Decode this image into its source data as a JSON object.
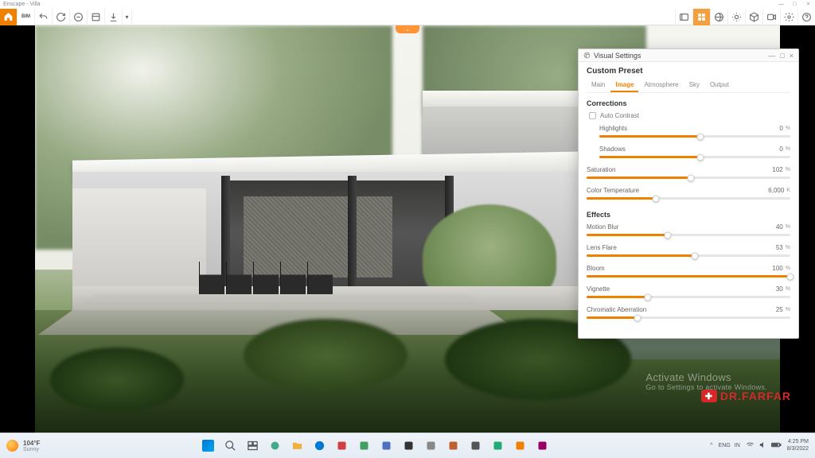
{
  "app": {
    "title": "Enscape - Villa"
  },
  "window_controls": {
    "min": "—",
    "max": "□",
    "close": "×"
  },
  "toolbar_left": [
    "home",
    "bim",
    "undo",
    "sync",
    "filter",
    "layers",
    "export",
    "dropdown"
  ],
  "toolbar_right": [
    "renders",
    "styles-active",
    "globe",
    "sun",
    "package",
    "video",
    "settings",
    "help"
  ],
  "handle_icon": "⌄",
  "panel": {
    "title": "Visual Settings",
    "preset": "Custom Preset",
    "tabs": [
      "Main",
      "Image",
      "Atmosphere",
      "Sky",
      "Output"
    ],
    "active_tab": 1,
    "section_corrections": "Corrections",
    "auto_contrast": {
      "label": "Auto Contrast",
      "checked": false
    },
    "sliders_corrections": [
      {
        "label": "Highlights",
        "value": 0,
        "unit": "%",
        "pct": 53,
        "indent": true
      },
      {
        "label": "Shadows",
        "value": 0,
        "unit": "%",
        "pct": 53,
        "indent": true
      },
      {
        "label": "Saturation",
        "value": 102,
        "unit": "%",
        "pct": 51
      },
      {
        "label": "Color Temperature",
        "value": "6,000",
        "unit": "K",
        "pct": 34
      }
    ],
    "section_effects": "Effects",
    "sliders_effects": [
      {
        "label": "Motion Blur",
        "value": 40,
        "unit": "%",
        "pct": 40
      },
      {
        "label": "Lens Flare",
        "value": 53,
        "unit": "%",
        "pct": 53
      },
      {
        "label": "Bloom",
        "value": 100,
        "unit": "%",
        "pct": 100
      },
      {
        "label": "Vignette",
        "value": 30,
        "unit": "%",
        "pct": 30
      },
      {
        "label": "Chromatic Aberration",
        "value": 25,
        "unit": "%",
        "pct": 25
      }
    ]
  },
  "watermark": {
    "l1": "Activate Windows",
    "l2": "Go to Settings to activate Windows."
  },
  "brand": "DR.FARFAR",
  "taskbar": {
    "weather": {
      "temp": "104°F",
      "label": "Sunny"
    },
    "sys": {
      "lang": "ENG",
      "region": "IN",
      "time": "4:25 PM",
      "date": "8/3/2022"
    }
  }
}
